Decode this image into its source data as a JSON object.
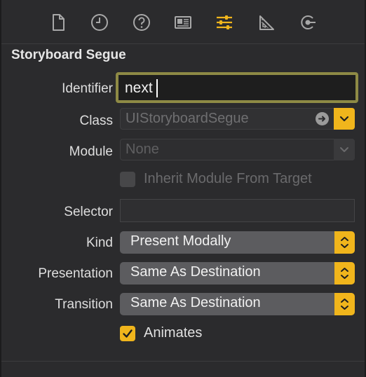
{
  "toolbar": {
    "icons": [
      {
        "name": "file-icon",
        "active": false
      },
      {
        "name": "history-icon",
        "active": false
      },
      {
        "name": "help-icon",
        "active": false
      },
      {
        "name": "identity-icon",
        "active": false
      },
      {
        "name": "attributes-icon",
        "active": true
      },
      {
        "name": "size-icon",
        "active": false
      },
      {
        "name": "connections-icon",
        "active": false
      }
    ],
    "active_color": "#f0b51c",
    "inactive_color": "#a8a8a8"
  },
  "section": {
    "title": "Storyboard Segue"
  },
  "identifier": {
    "label": "Identifier",
    "value": "next"
  },
  "class": {
    "label": "Class",
    "value": "UIStoryboardSegue"
  },
  "module": {
    "label": "Module",
    "value": "None"
  },
  "inherit": {
    "label": "Inherit Module From Target",
    "checked": false
  },
  "selector": {
    "label": "Selector",
    "value": ""
  },
  "kind": {
    "label": "Kind",
    "value": "Present Modally"
  },
  "presentation": {
    "label": "Presentation",
    "value": "Same As Destination"
  },
  "transition": {
    "label": "Transition",
    "value": "Same As Destination"
  },
  "animates": {
    "label": "Animates",
    "checked": true
  },
  "colors": {
    "accent": "#f0b51c",
    "focus_ring": "#8e8a45",
    "background": "#2b2b2d"
  }
}
